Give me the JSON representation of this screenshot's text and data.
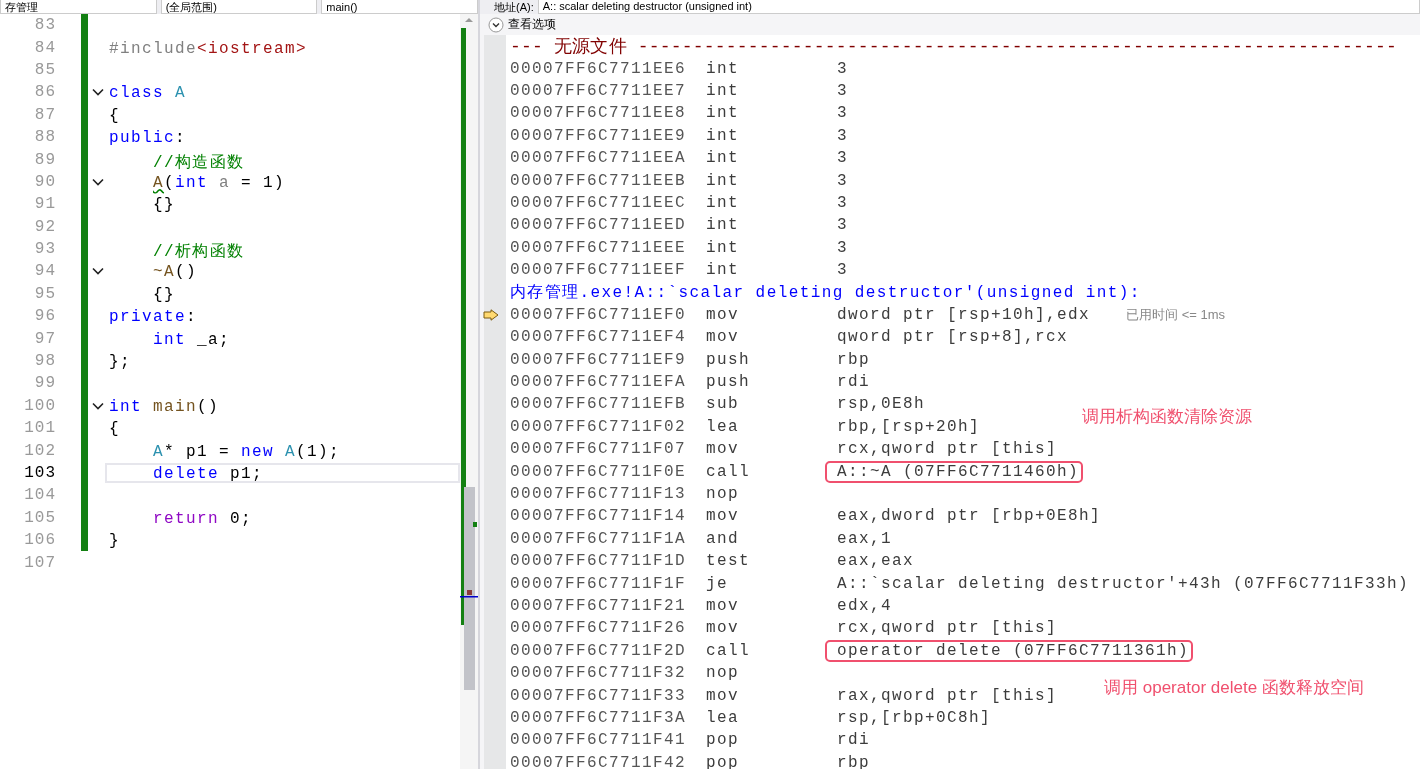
{
  "editor": {
    "dropdowns": [
      {
        "label": "存管理"
      },
      {
        "label": "(全局范围)"
      },
      {
        "label": "main()"
      }
    ],
    "lines": [
      {
        "number": "83",
        "changed": true,
        "fold": false,
        "current": false
      },
      {
        "number": "84",
        "changed": true,
        "fold": false,
        "current": false,
        "tokens": [
          {
            "text": "#include",
            "kind": "preproc"
          },
          {
            "text": "<iostream>",
            "kind": "string"
          }
        ]
      },
      {
        "number": "85",
        "changed": true,
        "fold": false,
        "current": false
      },
      {
        "number": "86",
        "changed": true,
        "fold": true,
        "current": false,
        "tokens": [
          {
            "text": "class",
            "kind": "keyword"
          },
          {
            "text": " A",
            "kind": "type"
          }
        ]
      },
      {
        "number": "87",
        "changed": true,
        "fold": false,
        "current": false,
        "tokens": [
          {
            "text": "{",
            "kind": "plain"
          }
        ]
      },
      {
        "number": "88",
        "changed": true,
        "fold": false,
        "current": false,
        "tokens": [
          {
            "text": "public",
            "kind": "keyword"
          },
          {
            "text": ":",
            "kind": "plain"
          }
        ]
      },
      {
        "number": "89",
        "changed": true,
        "fold": false,
        "current": false,
        "tokens": [
          {
            "text": "    //构造函数",
            "kind": "comment"
          }
        ]
      },
      {
        "number": "90",
        "changed": true,
        "fold": true,
        "current": false,
        "tokens": [
          {
            "text": "    A",
            "kind": "func",
            "squiggle": true
          },
          {
            "text": "(",
            "kind": "plain"
          },
          {
            "text": "int",
            "kind": "keyword"
          },
          {
            "text": " a",
            "kind": "param"
          },
          {
            "text": " = 1)",
            "kind": "plain"
          }
        ]
      },
      {
        "number": "91",
        "changed": true,
        "fold": false,
        "current": false,
        "tokens": [
          {
            "text": "    {}",
            "kind": "plain"
          }
        ]
      },
      {
        "number": "92",
        "changed": true,
        "fold": false,
        "current": false
      },
      {
        "number": "93",
        "changed": true,
        "fold": false,
        "current": false,
        "tokens": [
          {
            "text": "    //析构函数",
            "kind": "comment"
          }
        ]
      },
      {
        "number": "94",
        "changed": true,
        "fold": true,
        "current": false,
        "tokens": [
          {
            "text": "    ~A",
            "kind": "func"
          },
          {
            "text": "()",
            "kind": "plain"
          }
        ]
      },
      {
        "number": "95",
        "changed": true,
        "fold": false,
        "current": false,
        "tokens": [
          {
            "text": "    {}",
            "kind": "plain"
          }
        ]
      },
      {
        "number": "96",
        "changed": true,
        "fold": false,
        "current": false,
        "tokens": [
          {
            "text": "private",
            "kind": "keyword"
          },
          {
            "text": ":",
            "kind": "plain"
          }
        ]
      },
      {
        "number": "97",
        "changed": true,
        "fold": false,
        "current": false,
        "tokens": [
          {
            "text": "    int",
            "kind": "keyword"
          },
          {
            "text": " _a;",
            "kind": "plain"
          }
        ]
      },
      {
        "number": "98",
        "changed": true,
        "fold": false,
        "current": false,
        "tokens": [
          {
            "text": "};",
            "kind": "plain"
          }
        ]
      },
      {
        "number": "99",
        "changed": true,
        "fold": false,
        "current": false
      },
      {
        "number": "100",
        "changed": true,
        "fold": true,
        "current": false,
        "tokens": [
          {
            "text": "int",
            "kind": "keyword"
          },
          {
            "text": " main",
            "kind": "func"
          },
          {
            "text": "()",
            "kind": "plain"
          }
        ]
      },
      {
        "number": "101",
        "changed": true,
        "fold": false,
        "current": false,
        "tokens": [
          {
            "text": "{",
            "kind": "plain"
          }
        ]
      },
      {
        "number": "102",
        "changed": true,
        "fold": false,
        "current": false,
        "tokens": [
          {
            "text": "    A",
            "kind": "type"
          },
          {
            "text": "* p1 = ",
            "kind": "plain"
          },
          {
            "text": "new",
            "kind": "keyword"
          },
          {
            "text": " A",
            "kind": "type"
          },
          {
            "text": "(1);",
            "kind": "plain"
          }
        ]
      },
      {
        "number": "103",
        "changed": true,
        "fold": false,
        "current": true,
        "tokens": [
          {
            "text": "    delete",
            "kind": "keyword"
          },
          {
            "text": " p1;",
            "kind": "plain"
          }
        ]
      },
      {
        "number": "104",
        "changed": true,
        "fold": false,
        "current": false
      },
      {
        "number": "105",
        "changed": true,
        "fold": false,
        "current": false,
        "tokens": [
          {
            "text": "    return",
            "kind": "control"
          },
          {
            "text": " 0;",
            "kind": "plain"
          }
        ]
      },
      {
        "number": "106",
        "changed": true,
        "fold": false,
        "current": false,
        "tokens": [
          {
            "text": "}",
            "kind": "plain"
          }
        ]
      },
      {
        "number": "107",
        "changed": false,
        "fold": false,
        "current": false
      }
    ]
  },
  "disassembly": {
    "address_label": "地址(A):",
    "address": "A:: scalar deleting destructor (unsigned int)",
    "view_options": "查看选项",
    "rows": [
      {
        "kind": "header",
        "text": "--- 无源文件 ---------------------------------------------------------------------"
      },
      {
        "kind": "data",
        "address": "00007FF6C7711EE6",
        "op": "int",
        "operand": "3"
      },
      {
        "kind": "data",
        "address": "00007FF6C7711EE7",
        "op": "int",
        "operand": "3"
      },
      {
        "kind": "data",
        "address": "00007FF6C7711EE8",
        "op": "int",
        "operand": "3"
      },
      {
        "kind": "data",
        "address": "00007FF6C7711EE9",
        "op": "int",
        "operand": "3"
      },
      {
        "kind": "data",
        "address": "00007FF6C7711EEA",
        "op": "int",
        "operand": "3"
      },
      {
        "kind": "data",
        "address": "00007FF6C7711EEB",
        "op": "int",
        "operand": "3"
      },
      {
        "kind": "data",
        "address": "00007FF6C7711EEC",
        "op": "int",
        "operand": "3"
      },
      {
        "kind": "data",
        "address": "00007FF6C7711EED",
        "op": "int",
        "operand": "3"
      },
      {
        "kind": "data",
        "address": "00007FF6C7711EEE",
        "op": "int",
        "operand": "3"
      },
      {
        "kind": "data",
        "address": "00007FF6C7711EEF",
        "op": "int",
        "operand": "3"
      },
      {
        "kind": "label",
        "text": "内存管理.exe!A::`scalar deleting destructor'(unsigned int):"
      },
      {
        "kind": "instruction",
        "address": "00007FF6C7711EF0",
        "op": "mov",
        "operand": "dword ptr [rsp+10h],edx",
        "current": true,
        "boxed": false,
        "note": "已用时间 <= 1ms"
      },
      {
        "kind": "instruction",
        "address": "00007FF6C7711EF4",
        "op": "mov",
        "operand": "qword ptr [rsp+8],rcx",
        "current": false,
        "boxed": false
      },
      {
        "kind": "instruction",
        "address": "00007FF6C7711EF9",
        "op": "push",
        "operand": "rbp",
        "current": false,
        "boxed": false
      },
      {
        "kind": "instruction",
        "address": "00007FF6C7711EFA",
        "op": "push",
        "operand": "rdi",
        "current": false,
        "boxed": false
      },
      {
        "kind": "instruction",
        "address": "00007FF6C7711EFB",
        "op": "sub",
        "operand": "rsp,0E8h",
        "current": false,
        "boxed": false,
        "annotation": "调用析构函数清除资源"
      },
      {
        "kind": "instruction",
        "address": "00007FF6C7711F02",
        "op": "lea",
        "operand": "rbp,[rsp+20h]",
        "current": false,
        "boxed": false
      },
      {
        "kind": "instruction",
        "address": "00007FF6C7711F07",
        "op": "mov",
        "operand": "rcx,qword ptr [this]",
        "current": false,
        "boxed": false
      },
      {
        "kind": "instruction",
        "address": "00007FF6C7711F0E",
        "op": "call",
        "operand": "A::~A (07FF6C7711460h)",
        "current": false,
        "boxed": true
      },
      {
        "kind": "instruction",
        "address": "00007FF6C7711F13",
        "op": "nop",
        "current": false,
        "boxed": false
      },
      {
        "kind": "instruction",
        "address": "00007FF6C7711F14",
        "op": "mov",
        "operand": "eax,dword ptr [rbp+0E8h]",
        "current": false,
        "boxed": false
      },
      {
        "kind": "instruction",
        "address": "00007FF6C7711F1A",
        "op": "and",
        "operand": "eax,1",
        "current": false,
        "boxed": false
      },
      {
        "kind": "instruction",
        "address": "00007FF6C7711F1D",
        "op": "test",
        "operand": "eax,eax",
        "current": false,
        "boxed": false
      },
      {
        "kind": "instruction",
        "address": "00007FF6C7711F1F",
        "op": "je",
        "operand": "A::`scalar deleting destructor'+43h (07FF6C7711F33h)",
        "current": false,
        "boxed": false
      },
      {
        "kind": "instruction",
        "address": "00007FF6C7711F21",
        "op": "mov",
        "operand": "edx,4",
        "current": false,
        "boxed": false
      },
      {
        "kind": "instruction",
        "address": "00007FF6C7711F26",
        "op": "mov",
        "operand": "rcx,qword ptr [this]",
        "current": false,
        "boxed": false
      },
      {
        "kind": "instruction",
        "address": "00007FF6C7711F2D",
        "op": "call",
        "operand": "operator delete (07FF6C7711361h)",
        "current": false,
        "boxed": true
      },
      {
        "kind": "instruction",
        "address": "00007FF6C7711F32",
        "op": "nop",
        "current": false,
        "boxed": false
      },
      {
        "kind": "instruction",
        "address": "00007FF6C7711F33",
        "op": "mov",
        "operand": "rax,qword ptr [this]",
        "current": false,
        "boxed": false,
        "annotation": "调用 operator delete 函数释放空间"
      },
      {
        "kind": "instruction",
        "address": "00007FF6C7711F3A",
        "op": "lea",
        "operand": "rsp,[rbp+0C8h]",
        "current": false,
        "boxed": false
      },
      {
        "kind": "instruction",
        "address": "00007FF6C7711F41",
        "op": "pop",
        "operand": "rdi",
        "current": false,
        "boxed": false
      },
      {
        "kind": "instruction",
        "address": "00007FF6C7711F42",
        "op": "pop",
        "operand": "rbp",
        "current": false,
        "boxed": false
      }
    ]
  }
}
